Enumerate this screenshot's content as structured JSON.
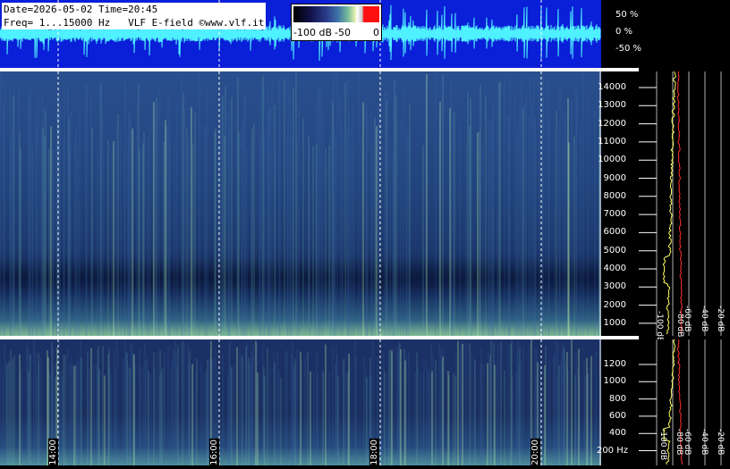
{
  "header": {
    "line1": "Date=2026-05-02 Time=20:45",
    "line2": "Freq= 1...15000 Hz   VLF E-field ©www.vlf.it"
  },
  "colorbar": {
    "labels": [
      "-100 dB",
      "-50",
      "0"
    ]
  },
  "waveform_axis": [
    "50 %",
    "0 %",
    "-50 %"
  ],
  "spectrogram_upper": {
    "freq_ticks": [
      "14000",
      "13000",
      "12000",
      "11000",
      "10000",
      "9000",
      "8000",
      "7000",
      "6000",
      "5000",
      "4000",
      "3000",
      "2000",
      "1000"
    ]
  },
  "spectrogram_lower": {
    "freq_ticks": [
      "1200",
      "1000",
      "800",
      "600",
      "400",
      "200 Hz"
    ]
  },
  "time_labels": [
    "14:00",
    "16:00",
    "18:00",
    "20:00"
  ],
  "profile_upper": {
    "db_labels": [
      "-100 dB",
      "-80 dB",
      "-60 dB",
      "-40 dB",
      "-20 dB"
    ]
  },
  "profile_lower": {
    "db_labels": [
      "-100 dB",
      "-80 dB",
      "-60 dB",
      "-40 dB",
      "-20 dB"
    ]
  },
  "colors": {
    "waveform_bg": "#0a1fd8",
    "waveform_trace": "#4ff0ff",
    "profile_avg": "#ffff60",
    "profile_peak": "#ff3030"
  }
}
